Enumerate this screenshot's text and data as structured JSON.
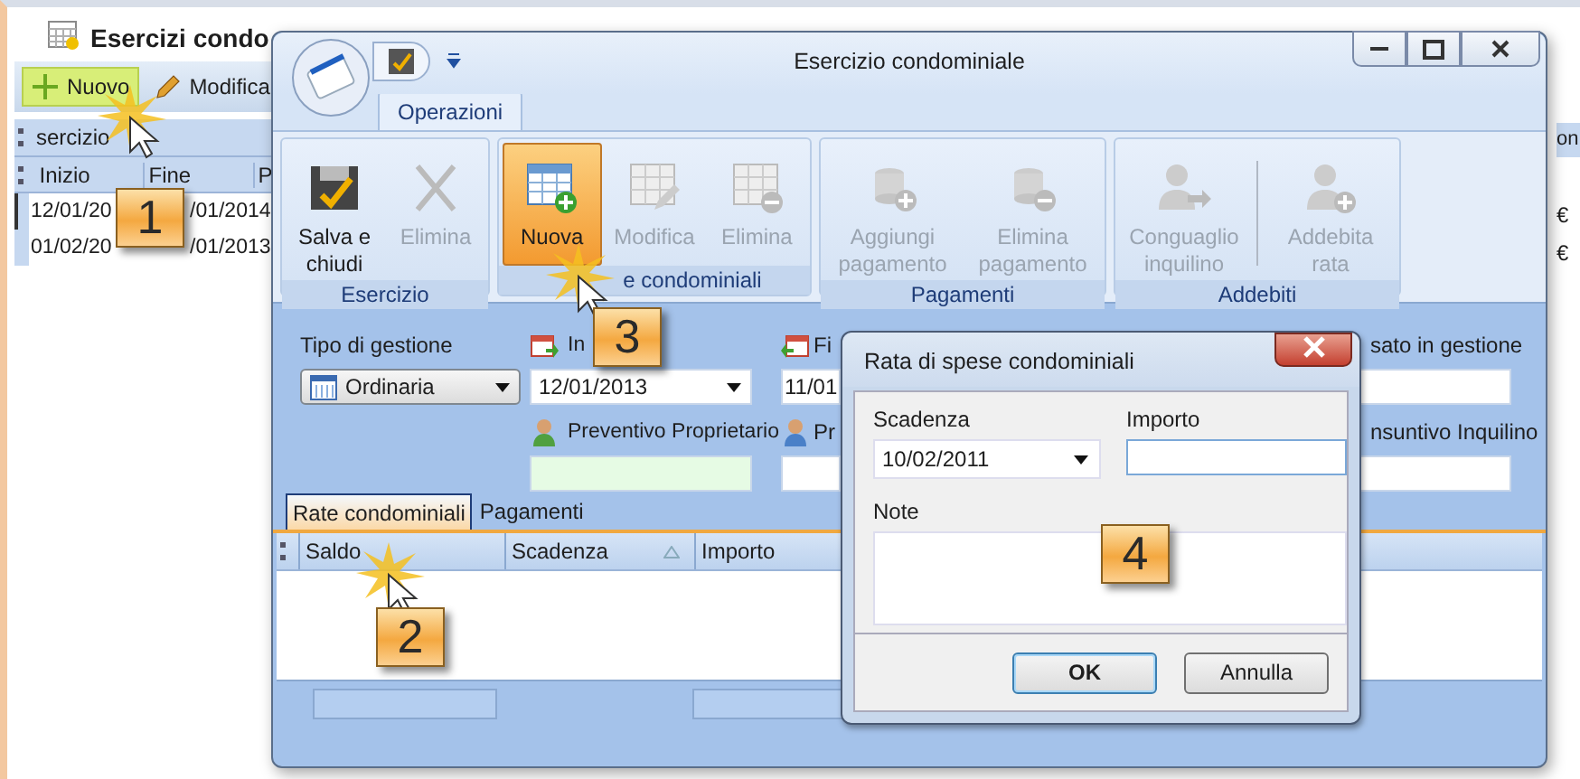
{
  "background_window": {
    "title": "Esercizi condo",
    "toolbar": [
      {
        "label": "Nuovo",
        "highlighted": true
      },
      {
        "label": "Modifica",
        "highlighted": false
      }
    ],
    "group_header": "sercizio",
    "columns": [
      "Inizio",
      "Fine",
      "P"
    ],
    "rows": [
      {
        "cells": [
          "12/01/20",
          "/01/2014"
        ],
        "selected": true
      },
      {
        "cells": [
          "01/02/20",
          "/01/2013"
        ],
        "selected": false
      }
    ],
    "right_edge": {
      "header": "on",
      "cells": [
        "€",
        "€"
      ]
    }
  },
  "window": {
    "title": "Esercizio condominiale",
    "tabs": [
      {
        "label": "Operazioni",
        "selected": true
      }
    ],
    "ribbon_groups": [
      {
        "label": "Esercizio",
        "buttons": [
          {
            "label": "Salva e\nchiudi",
            "disabled": false,
            "active": false
          },
          {
            "label": "Elimina",
            "disabled": true,
            "active": false
          }
        ]
      },
      {
        "label": "e condominiali",
        "buttons": [
          {
            "label": "Nuova",
            "disabled": false,
            "active": true
          },
          {
            "label": "Modifica",
            "disabled": true,
            "active": false
          },
          {
            "label": "Elimina",
            "disabled": true,
            "active": false
          }
        ]
      },
      {
        "label": "Pagamenti",
        "buttons": [
          {
            "label": "Aggiungi\npagamento",
            "disabled": true,
            "active": false
          },
          {
            "label": "Elimina\npagamento",
            "disabled": true,
            "active": false
          }
        ]
      },
      {
        "label": "Addebiti",
        "buttons": [
          {
            "label": "Conguaglio\ninquilino",
            "disabled": true,
            "active": false
          },
          {
            "label": "Addebita\nrata",
            "disabled": true,
            "active": false
          }
        ]
      }
    ],
    "form": [
      {
        "label": "Tipo di gestione",
        "kind": "dropdown",
        "value": "Ordinaria"
      },
      {
        "label": "In",
        "kind": "dropdown",
        "value": "12/01/2013"
      },
      {
        "label": "Fi",
        "kind": "text",
        "value": "11/01"
      },
      {
        "label": "sato in gestione",
        "kind": "text"
      },
      {
        "label": "Preventivo Proprietario",
        "kind": "text"
      },
      {
        "label": "Pr",
        "kind": "text"
      },
      {
        "label": "nsuntivo Inquilino",
        "kind": "text"
      }
    ],
    "detail_tabs": [
      {
        "label": "Rate condominiali",
        "selected": true
      },
      {
        "label": "Pagamenti",
        "selected": false
      }
    ],
    "grid_columns": [
      {
        "label": "Saldo",
        "sorted": false
      },
      {
        "label": "Scadenza",
        "sorted": true
      },
      {
        "label": "Importo",
        "sorted": false
      }
    ]
  },
  "dialog": {
    "title": "Rata di spese condominiali",
    "fields": [
      {
        "label": "Scadenza",
        "kind": "dropdown",
        "value": "10/02/2011"
      },
      {
        "label": "Importo",
        "kind": "text",
        "focused": true
      },
      {
        "label": "Note",
        "kind": "textarea"
      }
    ],
    "buttons": [
      {
        "label": "OK",
        "default": true
      },
      {
        "label": "Annulla",
        "default": false
      }
    ]
  },
  "callouts": [
    "1",
    "2",
    "3",
    "4"
  ]
}
